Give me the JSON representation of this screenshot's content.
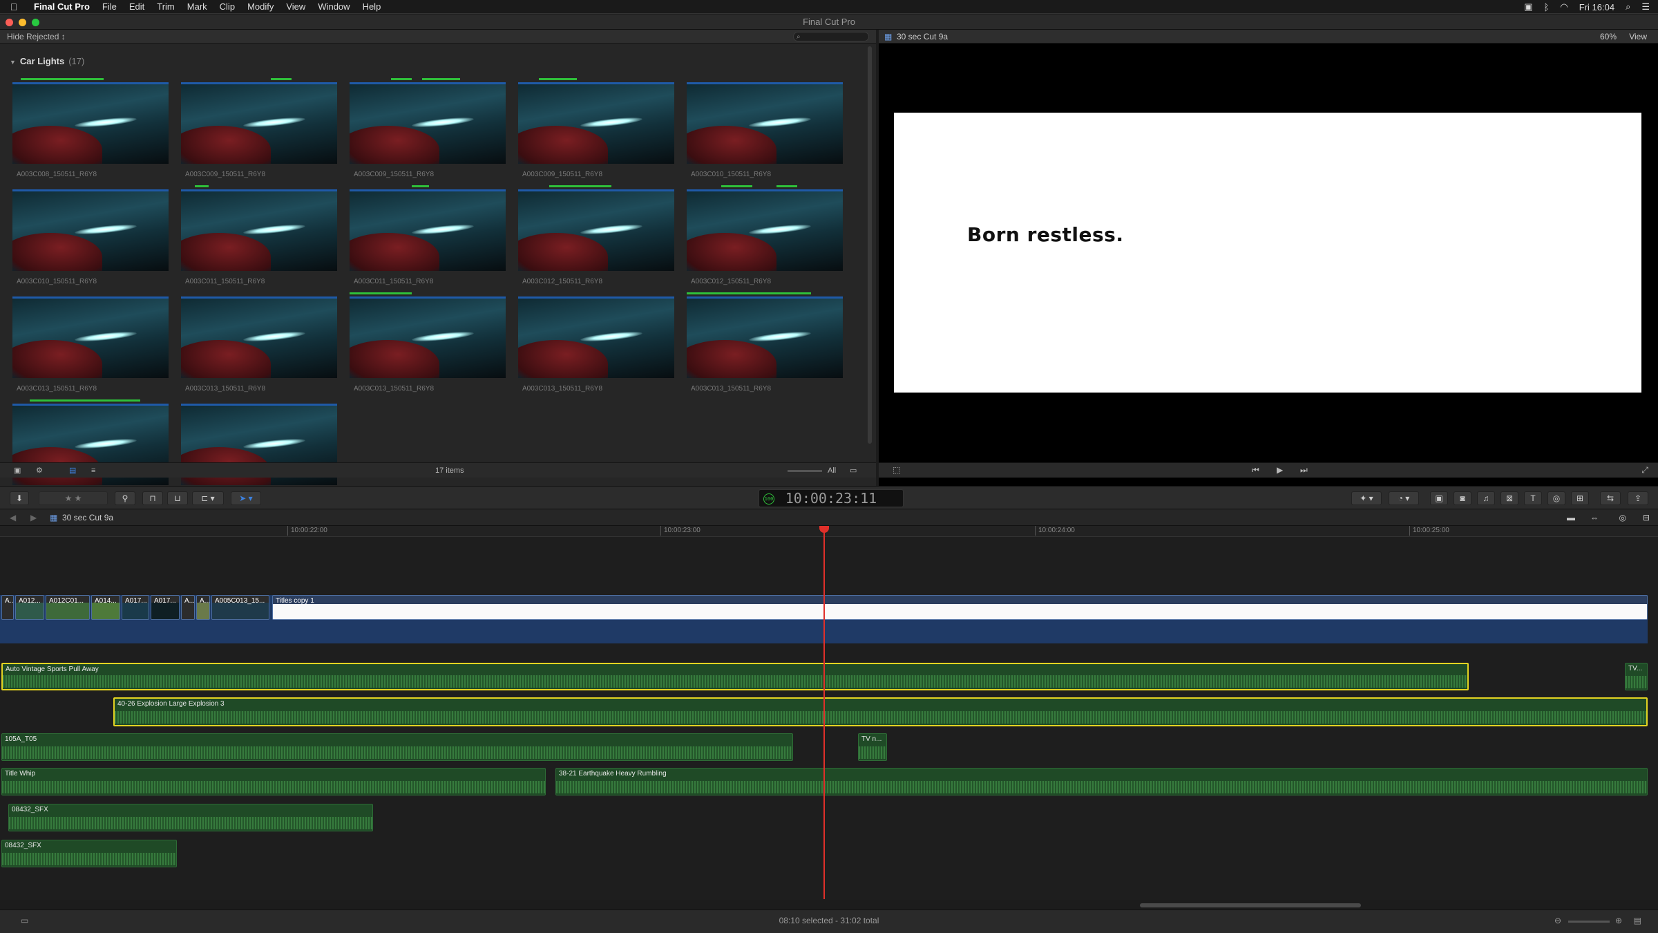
{
  "menubar": {
    "apple": "",
    "app_name": "Final Cut Pro",
    "items": [
      "File",
      "Edit",
      "Trim",
      "Mark",
      "Clip",
      "Modify",
      "View",
      "Window",
      "Help"
    ],
    "clock": "Fri 16:04"
  },
  "window": {
    "title": "Final Cut Pro"
  },
  "browser": {
    "filter_label": "Hide Rejected ↕",
    "event_name": "Car Lights",
    "event_count": "(17)",
    "item_count": "17 items",
    "zoom_all": "All",
    "clips": [
      {
        "name": "A003C008_150511_R6Y8"
      },
      {
        "name": "A003C009_150511_R6Y8"
      },
      {
        "name": "A003C009_150511_R6Y8"
      },
      {
        "name": "A003C009_150511_R6Y8"
      },
      {
        "name": "A003C010_150511_R6Y8"
      },
      {
        "name": "A003C010_150511_R6Y8"
      },
      {
        "name": "A003C011_150511_R6Y8"
      },
      {
        "name": "A003C011_150511_R6Y8"
      },
      {
        "name": "A003C012_150511_R6Y8"
      },
      {
        "name": "A003C012_150511_R6Y8"
      },
      {
        "name": "A003C013_150511_R6Y8"
      },
      {
        "name": "A003C013_150511_R6Y8"
      },
      {
        "name": "A003C013_150511_R6Y8"
      },
      {
        "name": "A003C013_150511_R6Y8"
      },
      {
        "name": "A003C013_150511_R6Y8"
      },
      {
        "name": ""
      },
      {
        "name": ""
      }
    ]
  },
  "viewer": {
    "project_name": "30 sec Cut 9a",
    "zoom": "60%",
    "view_menu": "View",
    "frame_text": "Born restless."
  },
  "toolbar": {
    "timecode": "10:00:23:11",
    "timecode_badge": "100"
  },
  "timeline": {
    "project_name": "30 sec Cut 9a",
    "ruler": [
      "10:00:22:00",
      "10:00:23:00",
      "10:00:24:00",
      "10:00:25:00"
    ],
    "video_clips": [
      "A...",
      "A012...",
      "A012C01...",
      "A014...",
      "A017...",
      "A017...",
      "A...",
      "A...",
      "A005C013_15..."
    ],
    "title_clip": "Titles copy 1",
    "audio_clips": [
      "Auto Vintage Sports Pull Away",
      "TV...",
      "40-26 Explosion Large Explosion 3",
      "105A_T05",
      "TV n...",
      "Title Whip",
      "38-21 Earthquake Heavy Rumbling",
      "08432_SFX",
      "08432_SFX"
    ]
  },
  "status": {
    "text": "08:10 selected - 31:02 total"
  },
  "colors": {
    "accent_blue": "#1f5aa8",
    "audio_green": "#2e6c36",
    "selection_yellow": "#e3d422",
    "playhead_red": "#e0302a"
  }
}
